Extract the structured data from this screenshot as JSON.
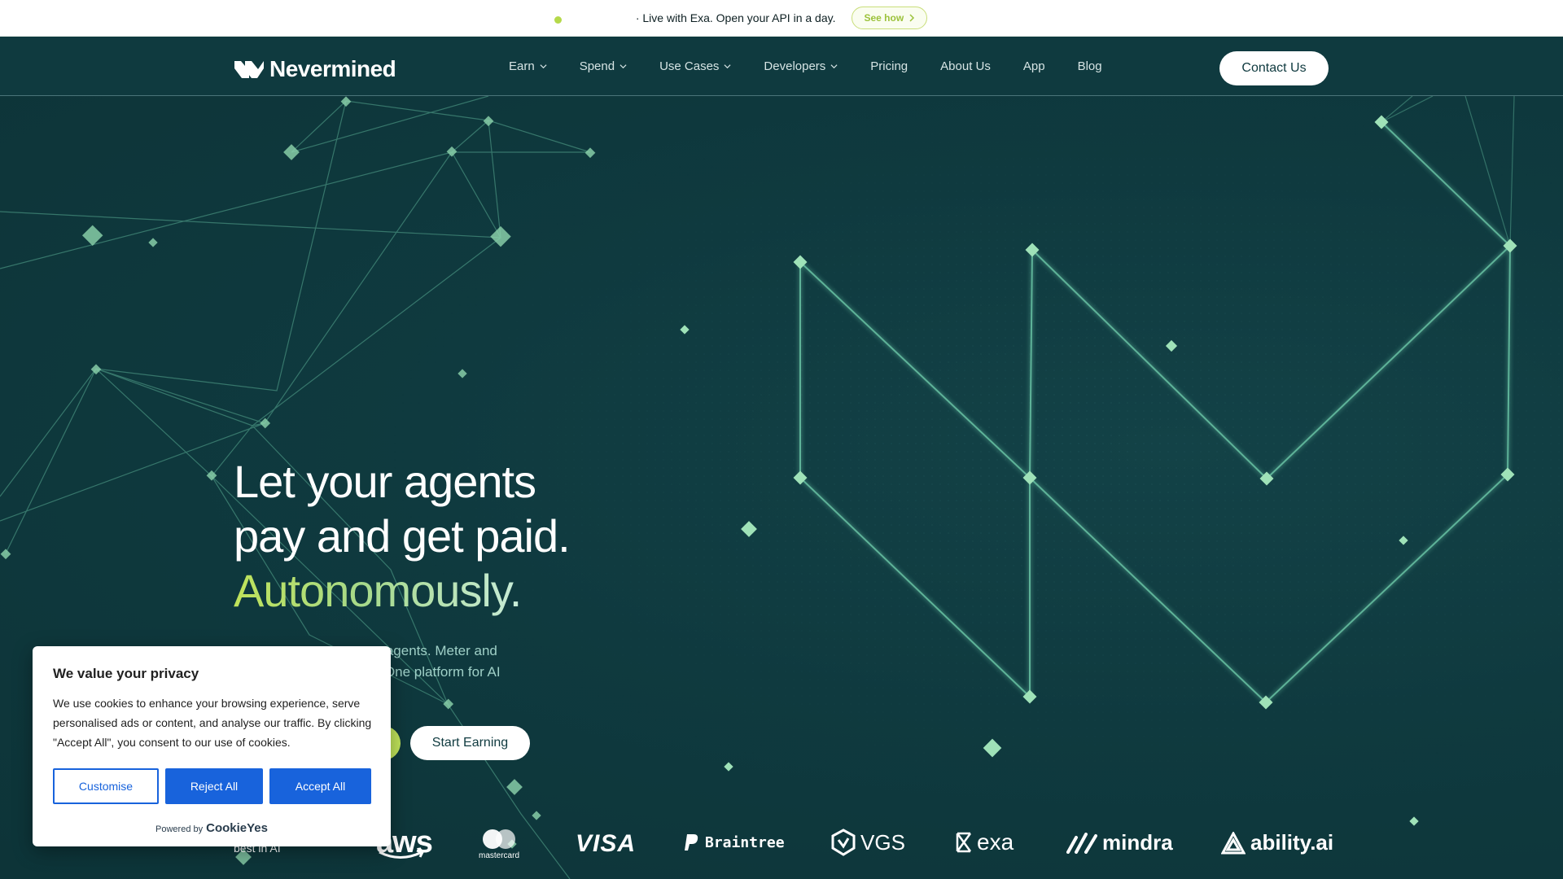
{
  "announcement": {
    "text": "· Live with Exa. Open your API in a day.",
    "cta_label": "See how"
  },
  "header": {
    "logo_text": "Nevermined",
    "nav": [
      {
        "label": "Earn",
        "dropdown": true
      },
      {
        "label": "Spend",
        "dropdown": true
      },
      {
        "label": "Use Cases",
        "dropdown": true
      },
      {
        "label": "Developers",
        "dropdown": true
      },
      {
        "label": "Pricing",
        "dropdown": false
      },
      {
        "label": "About Us",
        "dropdown": false
      },
      {
        "label": "App",
        "dropdown": false
      },
      {
        "label": "Blog",
        "dropdown": false
      }
    ],
    "contact_label": "Contact Us"
  },
  "hero": {
    "title_line1": "Let your agents",
    "title_line2": "pay and get paid.",
    "title_accent": "Autonomously.",
    "subtitle_line1": "ur agents. Meter and",
    "subtitle_line2": "s. One platform for AI",
    "start_earning_label": "Start Earning"
  },
  "logos": {
    "label": "best in AI",
    "partners": [
      "aws",
      "mastercard",
      "VISA",
      "Braintree",
      "VGS",
      "exa",
      "mindra",
      "ability.ai"
    ]
  },
  "cookie": {
    "title": "We value your privacy",
    "body": "We use cookies to enhance your browsing experience, serve personalised ads or content, and analyse our traffic. By clicking \"Accept All\", you consent to our use of cookies.",
    "customise_label": "Customise",
    "reject_label": "Reject All",
    "accept_label": "Accept All",
    "powered_by": "Powered by",
    "brand": "CookieYes"
  },
  "colors": {
    "background": "#0f3a3f",
    "accent_lime": "#bfe35a",
    "network_line": "#6cc8a8",
    "cookie_blue": "#1863dc"
  }
}
